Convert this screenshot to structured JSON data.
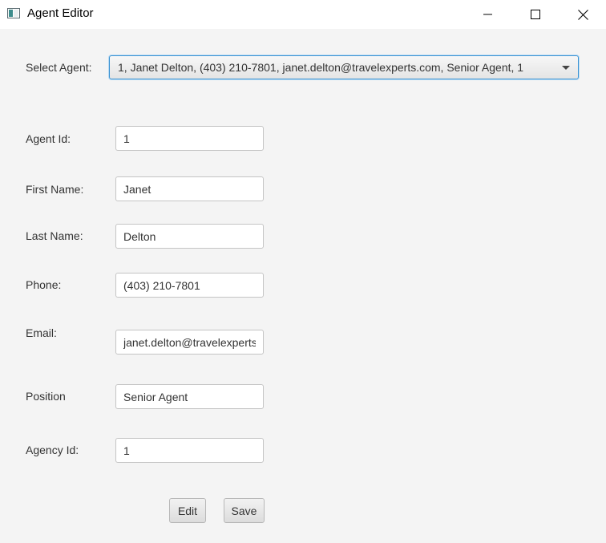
{
  "window": {
    "title": "Agent Editor",
    "icon": "app-window-icon",
    "controls": [
      "minimize-icon",
      "maximize-icon",
      "close-icon"
    ]
  },
  "select_agent": {
    "label": "Select Agent:",
    "value": "1, Janet Delton, (403) 210-7801, janet.delton@travelexperts.com, Senior Agent, 1"
  },
  "form": {
    "agent_id": {
      "label": "Agent Id:",
      "value": "1"
    },
    "first_name": {
      "label": "First Name:",
      "value": "Janet"
    },
    "last_name": {
      "label": "Last Name:",
      "value": "Delton"
    },
    "phone": {
      "label": "Phone:",
      "value": "(403) 210-7801"
    },
    "email": {
      "label": "Email:",
      "value": "janet.delton@travelexperts.com"
    },
    "position": {
      "label": "Position",
      "value": "Senior Agent"
    },
    "agency_id": {
      "label": "Agency Id:",
      "value": "1"
    }
  },
  "buttons": {
    "edit": "Edit",
    "save": "Save"
  },
  "colors": {
    "background": "#f4f4f4",
    "focus_border": "#3a93d4",
    "field_border": "#c4c4c4"
  }
}
